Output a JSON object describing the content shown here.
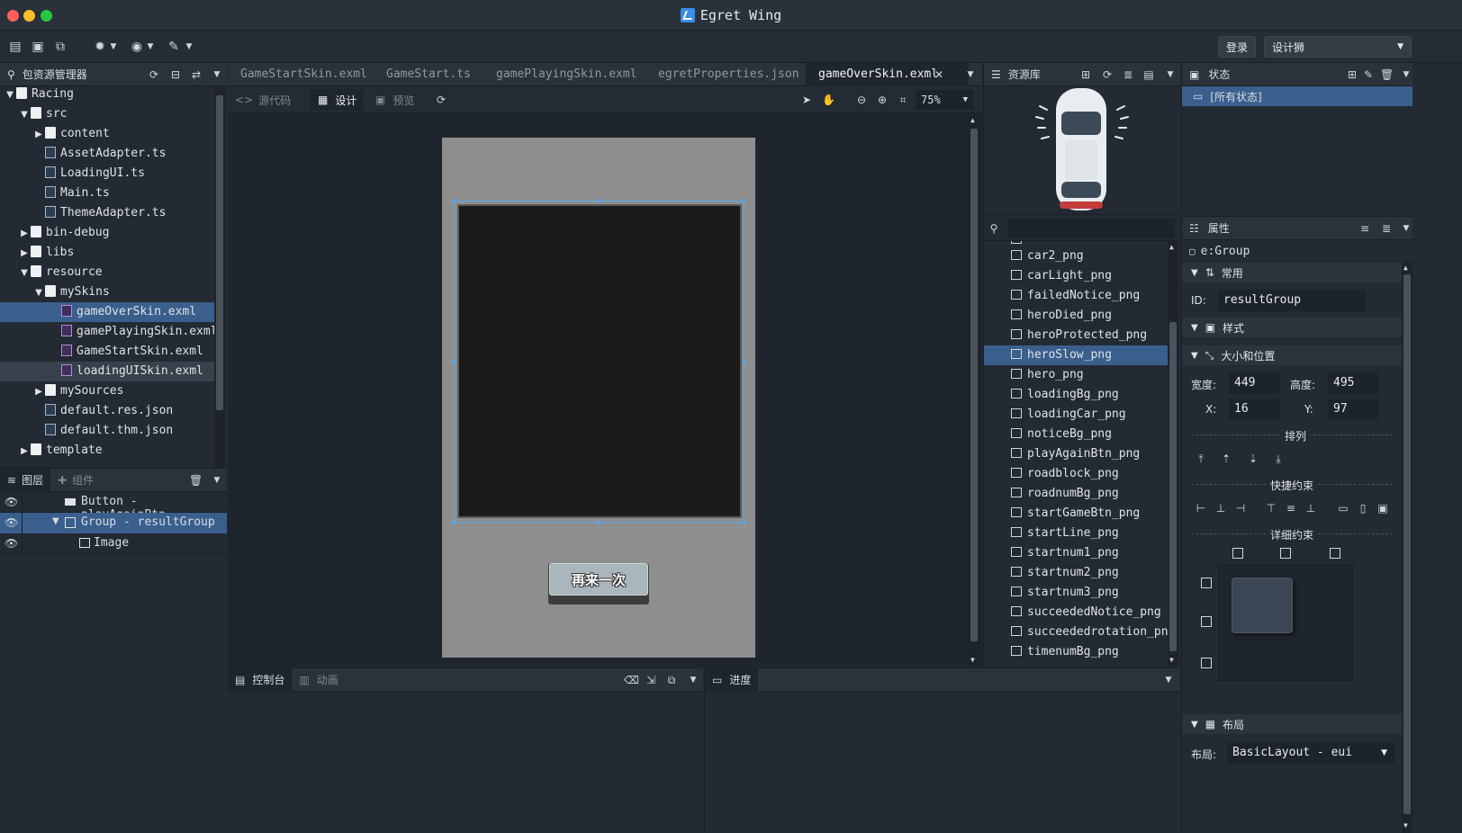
{
  "window": {
    "title": "Egret Wing"
  },
  "toolbar": {
    "login": "登录",
    "role": "设计狮"
  },
  "project": {
    "panel_title": "包资源管理器",
    "tree": [
      {
        "label": "Racing",
        "type": "project"
      },
      {
        "label": "src",
        "type": "pkg"
      },
      {
        "label": "content",
        "type": "pkg"
      },
      {
        "label": "AssetAdapter.ts",
        "type": "ts"
      },
      {
        "label": "LoadingUI.ts",
        "type": "ts"
      },
      {
        "label": "Main.ts",
        "type": "ts"
      },
      {
        "label": "ThemeAdapter.ts",
        "type": "ts"
      },
      {
        "label": "bin-debug",
        "type": "folder"
      },
      {
        "label": "libs",
        "type": "folder"
      },
      {
        "label": "resource",
        "type": "folder"
      },
      {
        "label": "mySkins",
        "type": "folder"
      },
      {
        "label": "gameOverSkin.exml",
        "type": "exml"
      },
      {
        "label": "gamePlayingSkin.exml",
        "type": "exml"
      },
      {
        "label": "GameStartSkin.exml",
        "type": "exml"
      },
      {
        "label": "loadingUISkin.exml",
        "type": "exml"
      },
      {
        "label": "mySources",
        "type": "folder"
      },
      {
        "label": "default.res.json",
        "type": "json"
      },
      {
        "label": "default.thm.json",
        "type": "json"
      },
      {
        "label": "template",
        "type": "folder"
      }
    ]
  },
  "layers": {
    "tab_layers": "图层",
    "tab_components": "组件",
    "items": [
      {
        "label": "Button - playAgainBtn"
      },
      {
        "label": "Group - resultGroup"
      },
      {
        "label": "Image"
      }
    ]
  },
  "editor": {
    "tabs": [
      "GameStartSkin.exml",
      "GameStart.ts",
      "gamePlayingSkin.exml",
      "egretProperties.json",
      "gameOverSkin.exml"
    ],
    "mode_source": "源代码",
    "mode_design": "设计",
    "mode_preview": "预览",
    "zoom": "75%",
    "canvas_button_label": "再来一次"
  },
  "bottom": {
    "console": "控制台",
    "animation": "动画",
    "progress": "进度"
  },
  "resources": {
    "panel_title": "资源库",
    "items": [
      "car2_png",
      "carLight_png",
      "failedNotice_png",
      "heroDied_png",
      "heroProtected_png",
      "heroSlow_png",
      "hero_png",
      "loadingBg_png",
      "loadingCar_png",
      "noticeBg_png",
      "playAgainBtn_png",
      "roadblock_png",
      "roadnumBg_png",
      "startGameBtn_png",
      "startLine_png",
      "startnum1_png",
      "startnum2_png",
      "startnum3_png",
      "succeededNotice_png",
      "succeededrotation_png",
      "timenumBg_png"
    ],
    "selected": "heroSlow_png"
  },
  "states": {
    "panel_title": "状态",
    "items": [
      "[所有状态]"
    ]
  },
  "properties": {
    "panel_title": "属性",
    "component": "e:Group",
    "sec_common": "常用",
    "id_label": "ID:",
    "id_value": "resultGroup",
    "sec_style": "样式",
    "sec_size": "大小和位置",
    "width_label": "宽度:",
    "width_value": "449",
    "height_label": "高度:",
    "height_value": "495",
    "x_label": "X:",
    "x_value": "16",
    "y_label": "Y:",
    "y_value": "97",
    "arrange": "排列",
    "quick_constraint": "快捷约束",
    "detail_constraint": "详细约束",
    "sec_layout": "布局",
    "layout_label": "布局:",
    "layout_value": "BasicLayout - eui"
  },
  "colors": {
    "accent": "#3a5f8c",
    "selection": "#5aa6e8",
    "canvas_bg": "#8e8e8e",
    "group_bg": "#1b1b1b"
  }
}
